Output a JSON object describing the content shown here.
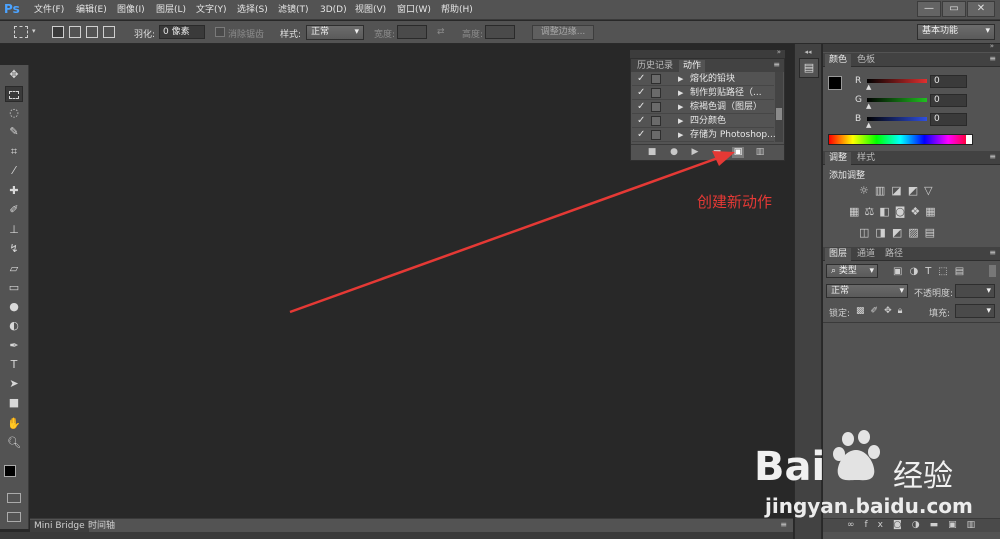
{
  "app": {
    "logo": "Ps"
  },
  "menu": [
    "文件(F)",
    "编辑(E)",
    "图像(I)",
    "图层(L)",
    "文字(Y)",
    "选择(S)",
    "滤镜(T)",
    "3D(D)",
    "视图(V)",
    "窗口(W)",
    "帮助(H)"
  ],
  "window_controls": {
    "minimize": "—",
    "restore": "▭",
    "close": "✕"
  },
  "options": {
    "feather_label": "羽化:",
    "feather_value": "0 像素",
    "antialias_label": "消除锯齿",
    "style_label": "样式:",
    "style_value": "正常",
    "width_label": "宽度:",
    "height_label": "高度:",
    "refine_edge": "调整边缘...",
    "workspace": "基本功能"
  },
  "actions_panel": {
    "tabs": [
      "历史记录",
      "动作"
    ],
    "active_tab": 1,
    "rows": [
      {
        "label": "熔化的铅块"
      },
      {
        "label": "制作剪贴路径（..."
      },
      {
        "label": "棕褐色调（图层）"
      },
      {
        "label": "四分颜色"
      },
      {
        "label": "存储为 Photoshop..."
      }
    ],
    "check_glyph": "✓",
    "arrow_glyph": "▶"
  },
  "annotation": {
    "text": "创建新动作",
    "color": "#e53935"
  },
  "color_panel": {
    "tabs": [
      "颜色",
      "色板"
    ],
    "channels": [
      {
        "name": "R",
        "value": "0",
        "color": "#e03030"
      },
      {
        "name": "G",
        "value": "0",
        "color": "#20c020"
      },
      {
        "name": "B",
        "value": "0",
        "color": "#3050e0"
      }
    ]
  },
  "adjust_panel": {
    "tabs": [
      "调整",
      "样式"
    ],
    "heading": "添加调整"
  },
  "layers_panel": {
    "tabs": [
      "图层",
      "通道",
      "路径"
    ],
    "filter_label": "类型",
    "blend_mode": "正常",
    "opacity_label": "不透明度:",
    "lock_label": "锁定:",
    "fill_label": "填充:"
  },
  "bottom_tabs": [
    "Mini Bridge",
    "时间轴"
  ],
  "watermark": {
    "brand": "Bai",
    "brand_cn": "经验",
    "url": "jingyan.baidu.com"
  }
}
